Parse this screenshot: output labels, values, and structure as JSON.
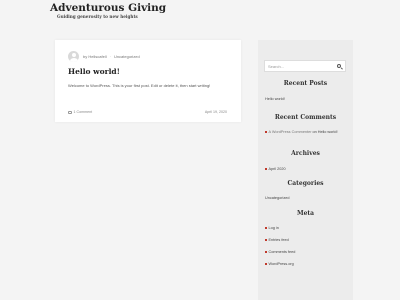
{
  "site": {
    "title": "Adventurous Giving",
    "tagline": "Guiding generosity to new heights"
  },
  "post": {
    "meta_by": "by",
    "author": "Hellscafell",
    "category": "Uncategorized",
    "title": "Hello world!",
    "excerpt": "Welcome to WordPress. This is your first post. Edit or delete it, then start writing!",
    "comments": "1 Comment",
    "date": "April 19, 2020"
  },
  "sidebar": {
    "search": {
      "placeholder": "Search..."
    },
    "recent_posts": {
      "title": "Recent Posts",
      "items": [
        "Hello world!"
      ]
    },
    "recent_comments": {
      "title": "Recent Comments",
      "comment": {
        "author": "A WordPress Commenter",
        "on": "on",
        "post": "Hello world!"
      }
    },
    "archives": {
      "title": "Archives",
      "items": [
        "April 2020"
      ]
    },
    "categories": {
      "title": "Categories",
      "items": [
        "Uncategorized"
      ]
    },
    "meta": {
      "title": "Meta",
      "items": [
        "Log in",
        "Entries feed",
        "Comments feed",
        "WordPress.org"
      ]
    }
  },
  "colors": {
    "background": "#f4f4f4",
    "card": "#ffffff",
    "sidebar": "#ececec",
    "accent_bullet": "#c0392b"
  }
}
